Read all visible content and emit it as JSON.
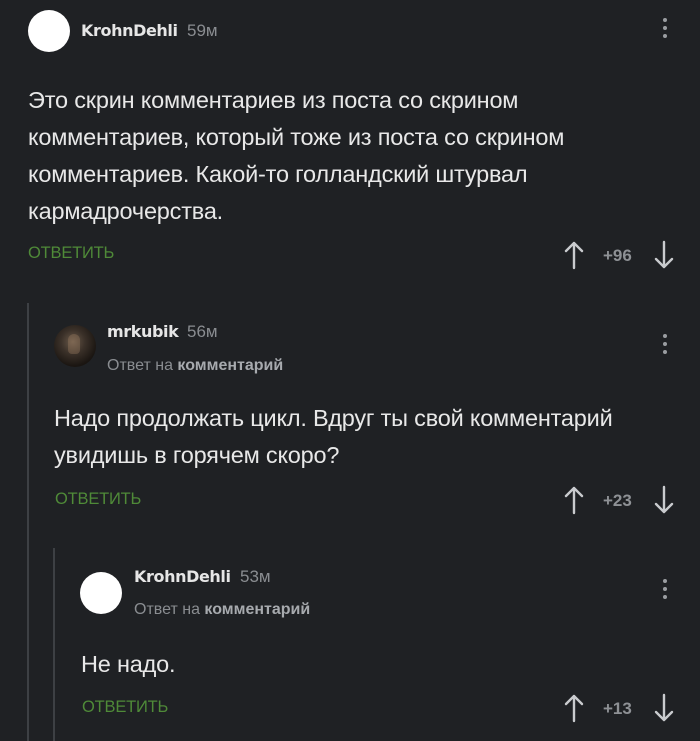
{
  "comments": [
    {
      "username": "KrohnDehli",
      "time": "59м",
      "reply_prefix": "",
      "reply_link": "",
      "text": "Это скрин комментариев из поста со скрином комментариев, который тоже из поста со скрином комментариев. Какой-то голландский штурвал кармадрочерства.",
      "reply_label": "ОТВЕТИТЬ",
      "score": "+96",
      "avatar": "white-circle"
    },
    {
      "username": "mrkubik",
      "time": "56м",
      "reply_prefix": "Ответ на ",
      "reply_link": "комментарий",
      "text": "Надо продолжать цикл. Вдруг ты свой комментарий увидишь в горячем скоро?",
      "reply_label": "ОТВЕТИТЬ",
      "score": "+23",
      "avatar": "photo"
    },
    {
      "username": "KrohnDehli",
      "time": "53м",
      "reply_prefix": "Ответ на ",
      "reply_link": "комментарий",
      "text": "Не надо.",
      "reply_label": "ОТВЕТИТЬ",
      "score": "+13",
      "avatar": "white-circle"
    }
  ],
  "icons": {
    "menu": "kebab-menu-icon",
    "upvote": "arrow-up-icon",
    "downvote": "arrow-down-icon"
  },
  "colors": {
    "background": "#1f2124",
    "reply_green": "#4f8a38",
    "muted": "#8a8d91"
  }
}
